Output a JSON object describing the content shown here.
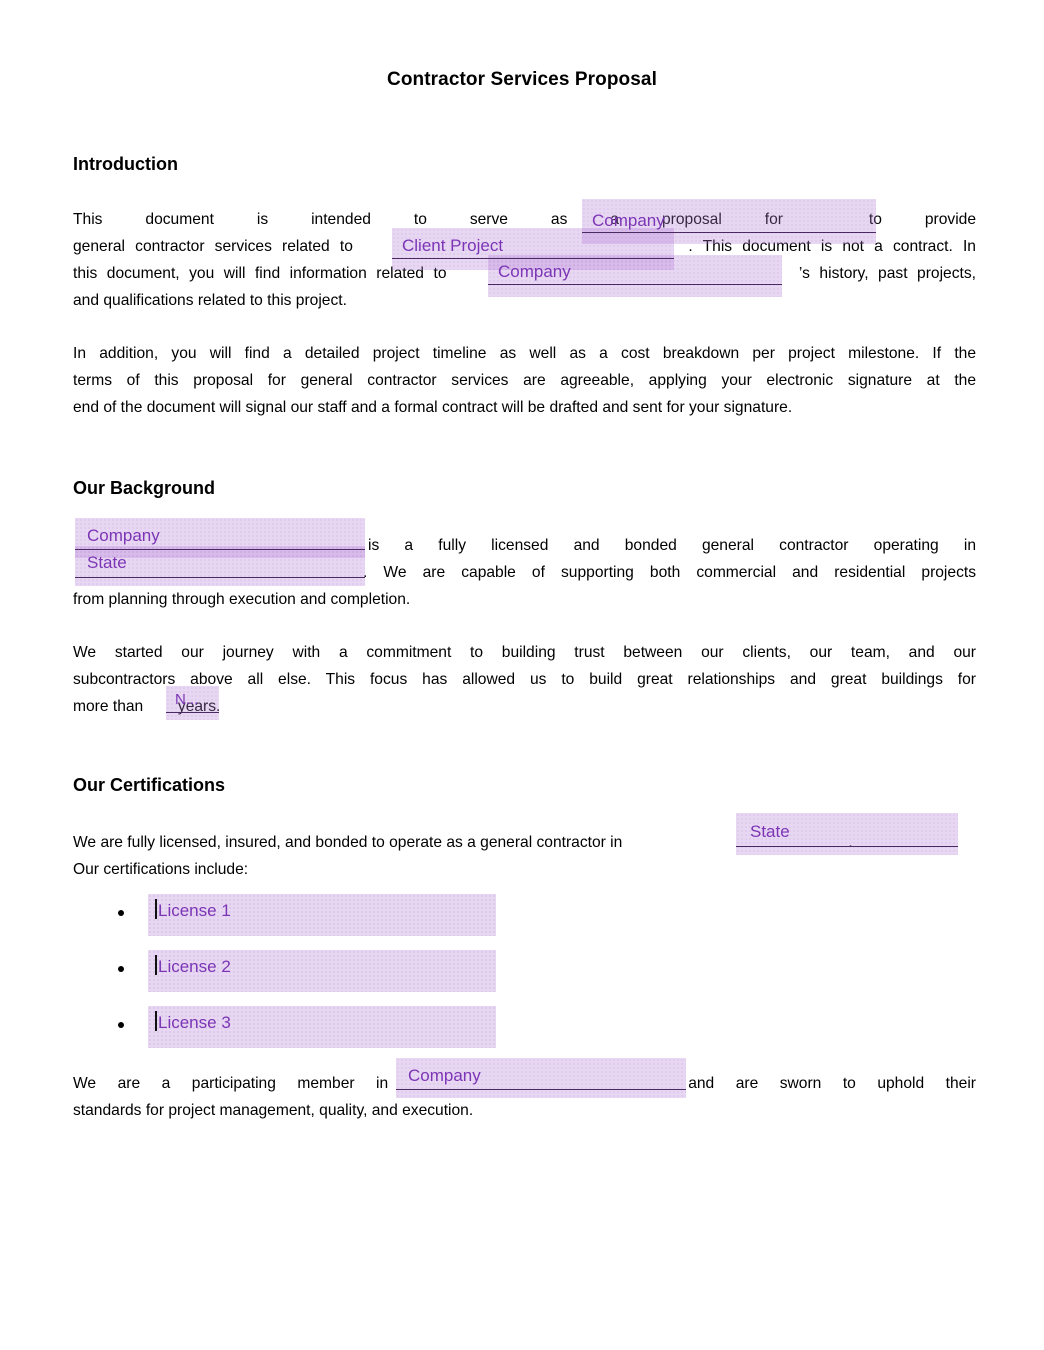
{
  "document": {
    "title": "Contractor Services Proposal"
  },
  "sections": {
    "introduction": {
      "heading": "Introduction",
      "paragraph1": {
        "t1": "This  document  is  intended  to  serve  as  a  proposal  for",
        "t2": "to  provide",
        "t3": "general contractor services related to",
        "t4": ". This document is not a contract. In",
        "t5": "this document, you will find information related to",
        "t6": "’s history, past projects,",
        "t7": "and qualifications related to this project."
      },
      "paragraph2": {
        "l1": "In addition, you will find a detailed project timeline as well as a cost breakdown per project milestone. If the",
        "l2": "terms of this proposal for general contractor services are agreeable, applying your electronic signature at the",
        "l3": "end of the document will signal our staff and a formal contract will be drafted and sent for your signature."
      }
    },
    "background": {
      "heading": "Our Background",
      "paragraph1": {
        "t1": "is  a  fully  licensed  and  bonded  general  contractor  operating  in",
        "t2": ". We are capable of supporting both commercial and residential projects",
        "t3": "from planning through execution and completion."
      },
      "paragraph2": {
        "l1": "We  started  our  journey  with  a  commitment  to  building  trust  between  our  clients,  our  team,  and  our",
        "l2": "subcontractors above all else. This focus has allowed us to build great relationships and great buildings for",
        "l3a": "more than",
        "l3b": "years."
      }
    },
    "certifications": {
      "heading": "Our Certifications",
      "paragraph1": {
        "t1": "We are fully licensed, insured, and bonded to operate as a general contractor in",
        "t2": ".",
        "t3": "Our certifications include:"
      },
      "list": [
        {
          "label": "License 1"
        },
        {
          "label": "License 2"
        },
        {
          "label": "License 3"
        }
      ],
      "paragraph2": {
        "t1": "We  are  a  participating  member  in",
        "t2": "and  are  sworn  to  uphold  their",
        "t3": "standards for project management, quality, and execution."
      }
    }
  },
  "fields": {
    "intro_company_1": "Company",
    "intro_client_project": "Client Project",
    "intro_company_2": "Company",
    "bg_company": "Company",
    "bg_state": "State",
    "bg_years": "N...",
    "cert_state": "State",
    "cert_company": "Company"
  },
  "colors": {
    "field_text": "#7b35b5",
    "field_fill": "rgba(178,122,214,0.30)",
    "field_rule": "#4b2a63",
    "body_text": "#000000",
    "page_background": "#ffffff"
  }
}
